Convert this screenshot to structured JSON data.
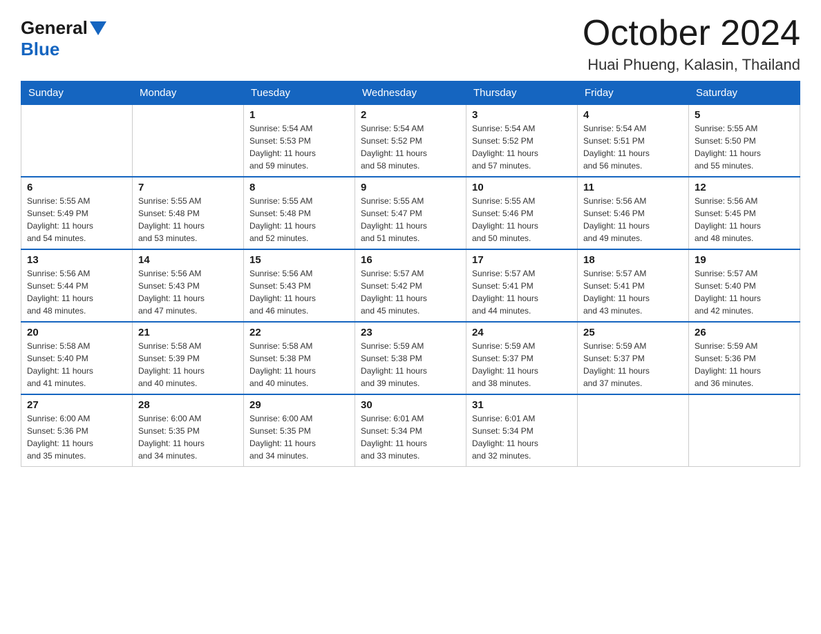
{
  "header": {
    "logo_general": "General",
    "logo_blue": "Blue",
    "month_title": "October 2024",
    "location": "Huai Phueng, Kalasin, Thailand"
  },
  "days_of_week": [
    "Sunday",
    "Monday",
    "Tuesday",
    "Wednesday",
    "Thursday",
    "Friday",
    "Saturday"
  ],
  "weeks": [
    [
      {
        "day": "",
        "info": ""
      },
      {
        "day": "",
        "info": ""
      },
      {
        "day": "1",
        "info": "Sunrise: 5:54 AM\nSunset: 5:53 PM\nDaylight: 11 hours\nand 59 minutes."
      },
      {
        "day": "2",
        "info": "Sunrise: 5:54 AM\nSunset: 5:52 PM\nDaylight: 11 hours\nand 58 minutes."
      },
      {
        "day": "3",
        "info": "Sunrise: 5:54 AM\nSunset: 5:52 PM\nDaylight: 11 hours\nand 57 minutes."
      },
      {
        "day": "4",
        "info": "Sunrise: 5:54 AM\nSunset: 5:51 PM\nDaylight: 11 hours\nand 56 minutes."
      },
      {
        "day": "5",
        "info": "Sunrise: 5:55 AM\nSunset: 5:50 PM\nDaylight: 11 hours\nand 55 minutes."
      }
    ],
    [
      {
        "day": "6",
        "info": "Sunrise: 5:55 AM\nSunset: 5:49 PM\nDaylight: 11 hours\nand 54 minutes."
      },
      {
        "day": "7",
        "info": "Sunrise: 5:55 AM\nSunset: 5:48 PM\nDaylight: 11 hours\nand 53 minutes."
      },
      {
        "day": "8",
        "info": "Sunrise: 5:55 AM\nSunset: 5:48 PM\nDaylight: 11 hours\nand 52 minutes."
      },
      {
        "day": "9",
        "info": "Sunrise: 5:55 AM\nSunset: 5:47 PM\nDaylight: 11 hours\nand 51 minutes."
      },
      {
        "day": "10",
        "info": "Sunrise: 5:55 AM\nSunset: 5:46 PM\nDaylight: 11 hours\nand 50 minutes."
      },
      {
        "day": "11",
        "info": "Sunrise: 5:56 AM\nSunset: 5:46 PM\nDaylight: 11 hours\nand 49 minutes."
      },
      {
        "day": "12",
        "info": "Sunrise: 5:56 AM\nSunset: 5:45 PM\nDaylight: 11 hours\nand 48 minutes."
      }
    ],
    [
      {
        "day": "13",
        "info": "Sunrise: 5:56 AM\nSunset: 5:44 PM\nDaylight: 11 hours\nand 48 minutes."
      },
      {
        "day": "14",
        "info": "Sunrise: 5:56 AM\nSunset: 5:43 PM\nDaylight: 11 hours\nand 47 minutes."
      },
      {
        "day": "15",
        "info": "Sunrise: 5:56 AM\nSunset: 5:43 PM\nDaylight: 11 hours\nand 46 minutes."
      },
      {
        "day": "16",
        "info": "Sunrise: 5:57 AM\nSunset: 5:42 PM\nDaylight: 11 hours\nand 45 minutes."
      },
      {
        "day": "17",
        "info": "Sunrise: 5:57 AM\nSunset: 5:41 PM\nDaylight: 11 hours\nand 44 minutes."
      },
      {
        "day": "18",
        "info": "Sunrise: 5:57 AM\nSunset: 5:41 PM\nDaylight: 11 hours\nand 43 minutes."
      },
      {
        "day": "19",
        "info": "Sunrise: 5:57 AM\nSunset: 5:40 PM\nDaylight: 11 hours\nand 42 minutes."
      }
    ],
    [
      {
        "day": "20",
        "info": "Sunrise: 5:58 AM\nSunset: 5:40 PM\nDaylight: 11 hours\nand 41 minutes."
      },
      {
        "day": "21",
        "info": "Sunrise: 5:58 AM\nSunset: 5:39 PM\nDaylight: 11 hours\nand 40 minutes."
      },
      {
        "day": "22",
        "info": "Sunrise: 5:58 AM\nSunset: 5:38 PM\nDaylight: 11 hours\nand 40 minutes."
      },
      {
        "day": "23",
        "info": "Sunrise: 5:59 AM\nSunset: 5:38 PM\nDaylight: 11 hours\nand 39 minutes."
      },
      {
        "day": "24",
        "info": "Sunrise: 5:59 AM\nSunset: 5:37 PM\nDaylight: 11 hours\nand 38 minutes."
      },
      {
        "day": "25",
        "info": "Sunrise: 5:59 AM\nSunset: 5:37 PM\nDaylight: 11 hours\nand 37 minutes."
      },
      {
        "day": "26",
        "info": "Sunrise: 5:59 AM\nSunset: 5:36 PM\nDaylight: 11 hours\nand 36 minutes."
      }
    ],
    [
      {
        "day": "27",
        "info": "Sunrise: 6:00 AM\nSunset: 5:36 PM\nDaylight: 11 hours\nand 35 minutes."
      },
      {
        "day": "28",
        "info": "Sunrise: 6:00 AM\nSunset: 5:35 PM\nDaylight: 11 hours\nand 34 minutes."
      },
      {
        "day": "29",
        "info": "Sunrise: 6:00 AM\nSunset: 5:35 PM\nDaylight: 11 hours\nand 34 minutes."
      },
      {
        "day": "30",
        "info": "Sunrise: 6:01 AM\nSunset: 5:34 PM\nDaylight: 11 hours\nand 33 minutes."
      },
      {
        "day": "31",
        "info": "Sunrise: 6:01 AM\nSunset: 5:34 PM\nDaylight: 11 hours\nand 32 minutes."
      },
      {
        "day": "",
        "info": ""
      },
      {
        "day": "",
        "info": ""
      }
    ]
  ]
}
